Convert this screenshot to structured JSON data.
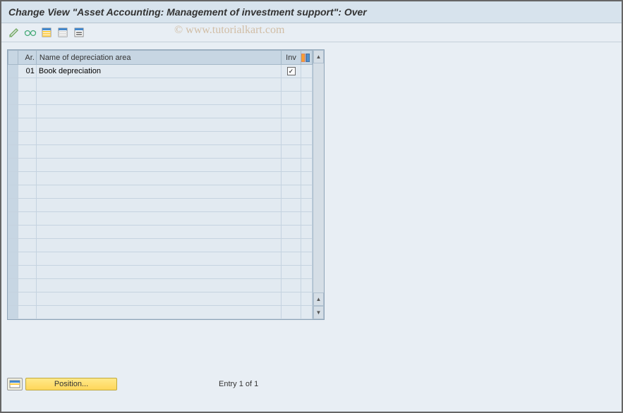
{
  "title": "Change View \"Asset Accounting: Management of investment support\": Over",
  "watermark": "© www.tutorialkart.com",
  "table": {
    "headers": {
      "sel": "",
      "ar": "Ar.",
      "name": "Name of depreciation area",
      "inv": "Inv"
    },
    "rows": [
      {
        "ar": "01",
        "name": "Book depreciation",
        "inv": true
      }
    ],
    "blank_rows": 18
  },
  "footer": {
    "position_btn": "Position...",
    "entry_text": "Entry 1 of 1"
  }
}
